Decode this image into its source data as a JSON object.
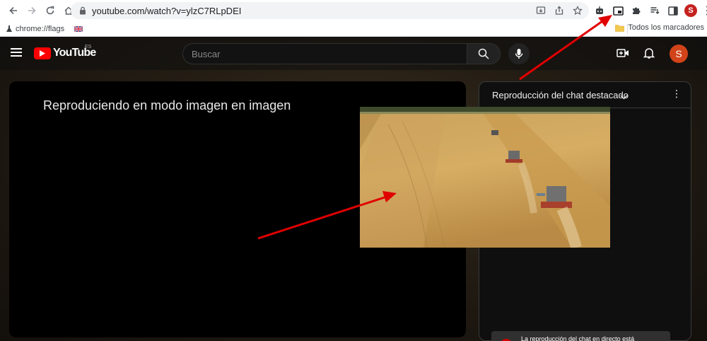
{
  "browser": {
    "url": "youtube.com/watch?v=ylzC7RLpDEI",
    "profile_initial": "S",
    "icons": [
      "back-icon",
      "forward-icon",
      "reload-icon",
      "home-icon",
      "lock-icon",
      "install-icon",
      "share-icon",
      "star-icon",
      "extension-robot-icon",
      "picture-in-picture-icon",
      "puzzle-icon",
      "reading-list-icon",
      "side-panel-icon",
      "menu-icon"
    ]
  },
  "bookmarks": {
    "items": [
      {
        "label": "chrome://flags",
        "icon": "flask-icon"
      },
      {
        "label": "",
        "icon": "uk-flag-icon"
      }
    ],
    "other_folder": "Todos los marcadores"
  },
  "youtube": {
    "logo_text": "YouTube",
    "region": "ES",
    "search_placeholder": "Buscar",
    "avatar_initial": "S",
    "player_message": "Reproduciendo en modo imagen en imagen",
    "chat": {
      "title": "Reproducción del chat destacado",
      "notice": "La reproducción del chat en directo está"
    }
  },
  "colors": {
    "yt_red": "#ff0000",
    "avatar": "#d14319",
    "arrow": "#e00000",
    "profile": "#c5221f"
  }
}
